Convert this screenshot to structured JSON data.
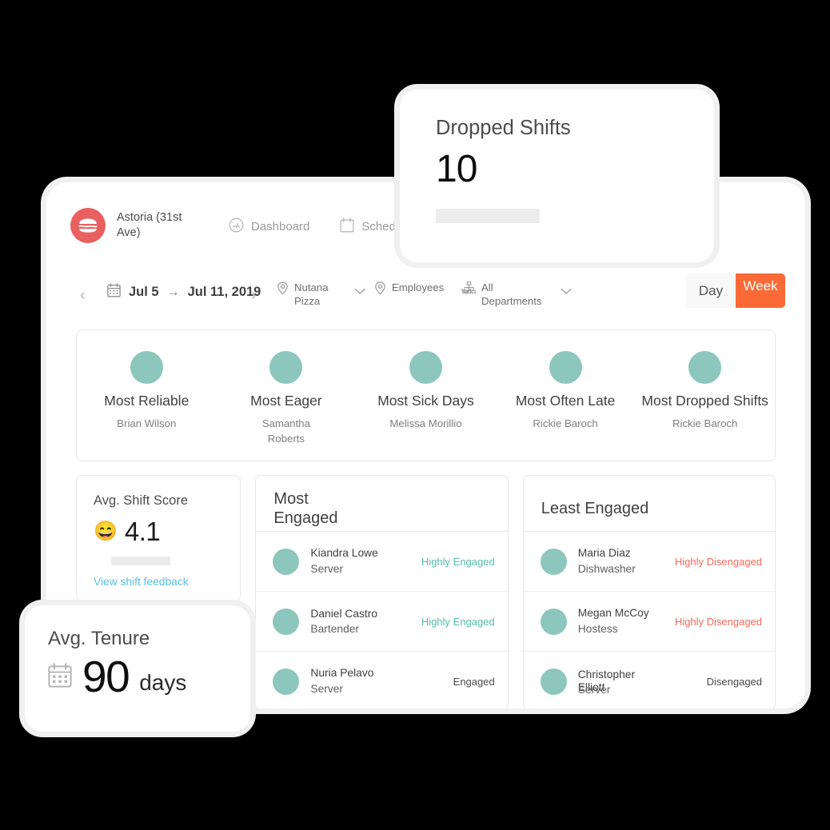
{
  "app": {
    "nav": {
      "brand_name": "Astoria (31st Ave)",
      "logo_icon": "burger-logo-icon",
      "logo_color": "#e8605f",
      "links": [
        {
          "label": "Dashboard",
          "icon": "gauge-icon"
        },
        {
          "label": "Schedules",
          "icon": "calendar-icon"
        }
      ]
    },
    "toolbar": {
      "prev_label": "‹",
      "next_label": "›",
      "calendar_icon": "calendar-icon",
      "date_start": "Jul 5",
      "date_arrow": "→",
      "date_end": "Jul 11, 2019",
      "filters": [
        {
          "label": "Nutana Pizza",
          "icon": "location-pin-icon",
          "chevron": "chevron-down-icon"
        },
        {
          "label": "Employees",
          "icon": "location-pin-icon",
          "chevron": "chevron-down-icon"
        },
        {
          "label": "All Departments",
          "icon": "org-chart-icon",
          "chevron": "chevron-down-icon"
        }
      ],
      "view_toggle": {
        "day_label": "Day",
        "week_label": "Week",
        "active": "Week",
        "active_color": "#f96a37"
      }
    },
    "leaders": {
      "avatar_color": "#8dc6bc",
      "items": [
        {
          "title": "Most Reliable",
          "person": "Brian Wilson"
        },
        {
          "title": "Most Eager",
          "person": "Samantha Roberts"
        },
        {
          "title": "Most Sick Days",
          "person": "Melissa Morillio"
        },
        {
          "title": "Most Often Late",
          "person": "Rickie Baroch"
        },
        {
          "title": "Most Dropped Shifts",
          "person": "Rickie Baroch"
        }
      ]
    },
    "shift_score": {
      "label": "Avg. Shift Score",
      "emoji": "😄",
      "value": "4.1",
      "link_label": "View shift feedback",
      "link_color": "#5cbee4"
    },
    "most_engaged": {
      "title": "Most Engaged",
      "rows": [
        {
          "name": "Kiandra Lowe",
          "role": "Server",
          "status": "Highly Engaged",
          "status_kind": "st-high-eng"
        },
        {
          "name": "Daniel Castro",
          "role": "Bartender",
          "status": "Highly Engaged",
          "status_kind": "st-high-eng"
        },
        {
          "name": "Nuria Pelavo",
          "role": "Server",
          "status": "Engaged",
          "status_kind": "st-eng"
        }
      ]
    },
    "least_engaged": {
      "title": "Least Engaged",
      "rows": [
        {
          "name": "Maria Diaz",
          "role": "Dishwasher",
          "status": "Highly Disengaged",
          "status_kind": "st-high-dis"
        },
        {
          "name": "Megan McCoy",
          "role": "Hostess",
          "status": "Highly Disengaged",
          "status_kind": "st-high-dis"
        },
        {
          "name": "Christopher Elliott",
          "role": "Server",
          "status": "Disengaged",
          "status_kind": "st-dis"
        }
      ]
    }
  },
  "dropped_shifts_card": {
    "title": "Dropped Shifts",
    "value": "10"
  },
  "avg_tenure_card": {
    "title": "Avg. Tenure",
    "icon": "calendar-icon",
    "value": "90",
    "unit": "days"
  }
}
